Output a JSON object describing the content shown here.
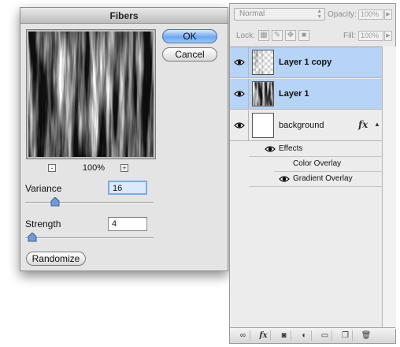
{
  "fibers_dialog": {
    "title": "Fibers",
    "zoom": {
      "minus": "-",
      "level": "100%",
      "plus": "+"
    },
    "buttons": {
      "ok": "OK",
      "cancel": "Cancel",
      "randomize": "Randomize"
    },
    "variance": {
      "label": "Variance",
      "value": "16",
      "slider_fraction": 0.25
    },
    "strength": {
      "label": "Strength",
      "value": "4",
      "slider_fraction": 0.05
    }
  },
  "layers_panel": {
    "blend_mode": "Normal",
    "opacity_label": "Opacity:",
    "opacity_value": "100%",
    "lock_label": "Lock:",
    "fill_label": "Fill:",
    "fill_value": "100%",
    "layers": [
      {
        "name": "Layer 1 copy",
        "selected": true,
        "thumbnail": "checkerboard-fibers"
      },
      {
        "name": "Layer 1",
        "selected": true,
        "thumbnail": "fibers"
      },
      {
        "name": "background",
        "selected": false,
        "thumbnail": "white",
        "fx": "fx"
      }
    ],
    "effects": {
      "header": "Effects",
      "items": [
        "Color Overlay",
        "Gradient Overlay"
      ]
    },
    "bottom_tools": [
      "link-icon",
      "fx-icon",
      "mask-icon",
      "adjustment-icon",
      "group-folder-icon",
      "new-layer-icon",
      "trash-icon"
    ]
  }
}
